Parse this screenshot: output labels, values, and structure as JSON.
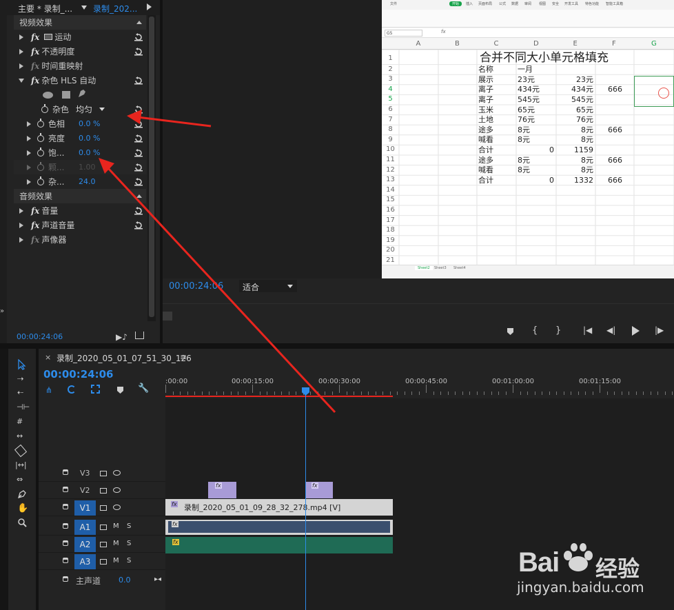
{
  "effect_controls": {
    "tab_master": "主要 * 录制_...",
    "tab_clip": "录制_202...",
    "video_effects_label": "视频效果",
    "items": [
      {
        "label": "运动"
      },
      {
        "label": "不透明度"
      },
      {
        "label": "时间重映射"
      },
      {
        "label": "杂色 HLS 自动"
      }
    ],
    "noise_param": {
      "label": "杂色",
      "value": "均匀"
    },
    "params": [
      {
        "label": "色相",
        "value": "0.0 %"
      },
      {
        "label": "亮度",
        "value": "0.0 %"
      },
      {
        "label": "饱...",
        "value": "0.0 %"
      },
      {
        "label": "颗...",
        "value": "1.00"
      },
      {
        "label": "杂...",
        "value": "24.0"
      }
    ],
    "audio_effects_label": "音频效果",
    "audio_items": [
      {
        "label": "音量"
      },
      {
        "label": "声道音量"
      },
      {
        "label": "声像器"
      }
    ],
    "timecode": "00:00:24:06"
  },
  "program_monitor": {
    "timecode": "00:00:24:06",
    "fit_label": "适合"
  },
  "spreadsheet": {
    "menu": [
      "文件",
      "开始",
      "插入",
      "页面布局",
      "公式",
      "数据",
      "审阅",
      "视图",
      "安全",
      "开发工具",
      "特色功能",
      "智能工具箱"
    ],
    "name_box": "G5",
    "fx_symbol": "fx",
    "columns": [
      "A",
      "B",
      "C",
      "D",
      "E",
      "F",
      "G"
    ],
    "row_numbers": [
      "1",
      "2",
      "3",
      "4",
      "5",
      "6",
      "7",
      "8",
      "9",
      "10",
      "11",
      "12",
      "13",
      "14",
      "15",
      "16",
      "17",
      "18",
      "19",
      "20",
      "21"
    ],
    "title": "合并不同大小单元格填充",
    "rows": [
      {
        "c": "名称",
        "d": "一月",
        "e": "",
        "f": ""
      },
      {
        "c": "展示",
        "d": "23元",
        "e": "23元",
        "f": ""
      },
      {
        "c": "离子",
        "d": "434元",
        "e": "434元",
        "f": "666"
      },
      {
        "c": "离子",
        "d": "545元",
        "e": "545元",
        "f": ""
      },
      {
        "c": "玉米",
        "d": "65元",
        "e": "65元",
        "f": ""
      },
      {
        "c": "土地",
        "d": "76元",
        "e": "76元",
        "f": ""
      },
      {
        "c": "途多",
        "d": "8元",
        "e": "8元",
        "f": "666"
      },
      {
        "c": "喊看",
        "d": "8元",
        "e": "8元",
        "f": ""
      },
      {
        "c": "合计",
        "d": "0",
        "e": "1159",
        "f": ""
      },
      {
        "c": "途多",
        "d": "8元",
        "e": "8元",
        "f": "666"
      },
      {
        "c": "喊看",
        "d": "8元",
        "e": "8元",
        "f": ""
      },
      {
        "c": "合计",
        "d": "0",
        "e": "1332",
        "f": "666"
      }
    ],
    "sheets": [
      "Sheet2",
      "Sheet3",
      "Sheet4"
    ]
  },
  "timeline": {
    "sequence_name": "录制_2020_05_01_07_51_30_126",
    "timecode": "00:00:24:06",
    "ruler": [
      ":00:00",
      "00:00:15:00",
      "00:00:30:00",
      "00:00:45:00",
      "00:01:00:00",
      "00:01:15:00"
    ],
    "tracks": [
      {
        "name": "V3",
        "patch": ""
      },
      {
        "name": "V2",
        "patch": ""
      },
      {
        "name": "V1",
        "patch": "V1"
      },
      {
        "name": "A1",
        "patch": "A1",
        "m": "M",
        "s": "S"
      },
      {
        "name": "A2",
        "patch": "A2",
        "m": "M",
        "s": "S"
      },
      {
        "name": "A3",
        "patch": "A3",
        "m": "M",
        "s": "S"
      }
    ],
    "master_label": "主声道",
    "master_value": "0.0",
    "clip_v1": "录制_2020_05_01_09_28_32_278.mp4 [V]",
    "fx_badge": "fx"
  },
  "watermark": {
    "brand": "Bai",
    "brand_cn": "经验",
    "url": "jingyan.baidu.com"
  },
  "colors": {
    "accent_blue": "#2d8ceb",
    "clip_purple": "#a89bd6",
    "clip_audio_green": "#1f6b55",
    "clip_audio_blue": "#3b4f6e",
    "arrow_red": "#e8251e"
  }
}
